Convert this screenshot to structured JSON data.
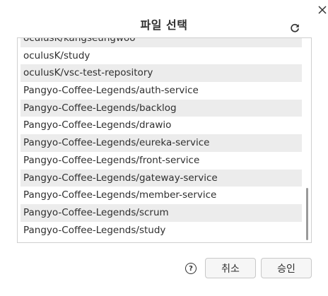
{
  "dialog": {
    "title": "파일 선택",
    "close_icon": "close-icon",
    "refresh_icon": "refresh-icon",
    "help_icon": "help-icon",
    "help_glyph": "?",
    "cancel_label": "취소",
    "ok_label": "승인"
  },
  "repositories": [
    "oculusK/kangseungwoo",
    "oculusK/study",
    "oculusK/vsc-test-repository",
    "Pangyo-Coffee-Legends/auth-service",
    "Pangyo-Coffee-Legends/backlog",
    "Pangyo-Coffee-Legends/drawio",
    "Pangyo-Coffee-Legends/eureka-service",
    "Pangyo-Coffee-Legends/front-service",
    "Pangyo-Coffee-Legends/gateway-service",
    "Pangyo-Coffee-Legends/member-service",
    "Pangyo-Coffee-Legends/scrum",
    "Pangyo-Coffee-Legends/study"
  ],
  "colors": {
    "row_alt": "#ececec",
    "border": "#cfcfcf",
    "scrollbar": "#9a9a9a"
  }
}
